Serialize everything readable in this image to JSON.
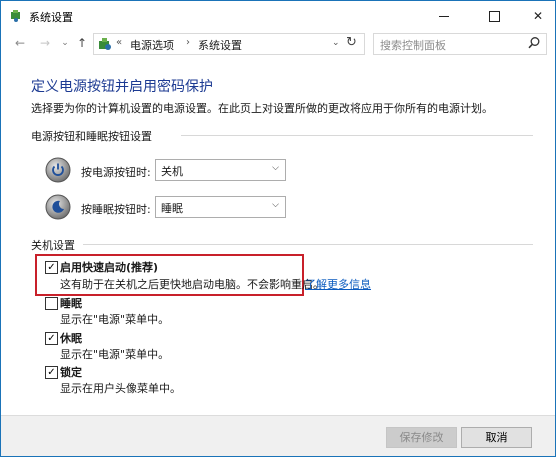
{
  "window": {
    "title": "系统设置"
  },
  "navigation": {
    "breadcrumb_prefix": "«",
    "crumbs": [
      "电源选项",
      "系统设置"
    ],
    "crumb_separator": "›",
    "search_placeholder": "搜索控制面板"
  },
  "content": {
    "heading": "定义电源按钮并启用密码保护",
    "description": "选择要为你的计算机设置的电源设置。在此页上对设置所做的更改将应用于你所有的电源计划。",
    "power_group_label": "电源按钮和睡眠按钮设置",
    "power_button": {
      "label": "按电源按钮时:",
      "value": "关机"
    },
    "sleep_button": {
      "label": "按睡眠按钮时:",
      "value": "睡眠"
    },
    "shutdown_group_label": "关机设置",
    "options": [
      {
        "label": "启用快速启动(推荐)",
        "desc": "这有助于在关机之后更快地启动电脑。不会影响重启。",
        "checked": true
      },
      {
        "label": "睡眠",
        "desc": "显示在\"电源\"菜单中。",
        "checked": false
      },
      {
        "label": "休眠",
        "desc": "显示在\"电源\"菜单中。",
        "checked": true
      },
      {
        "label": "锁定",
        "desc": "显示在用户头像菜单中。",
        "checked": true
      }
    ],
    "learn_more": "了解更多信息"
  },
  "footer": {
    "save_label": "保存修改",
    "cancel_label": "取消"
  },
  "colors": {
    "heading": "#1c3a92",
    "link": "#0b5bbf",
    "highlight": "#c8202a"
  }
}
